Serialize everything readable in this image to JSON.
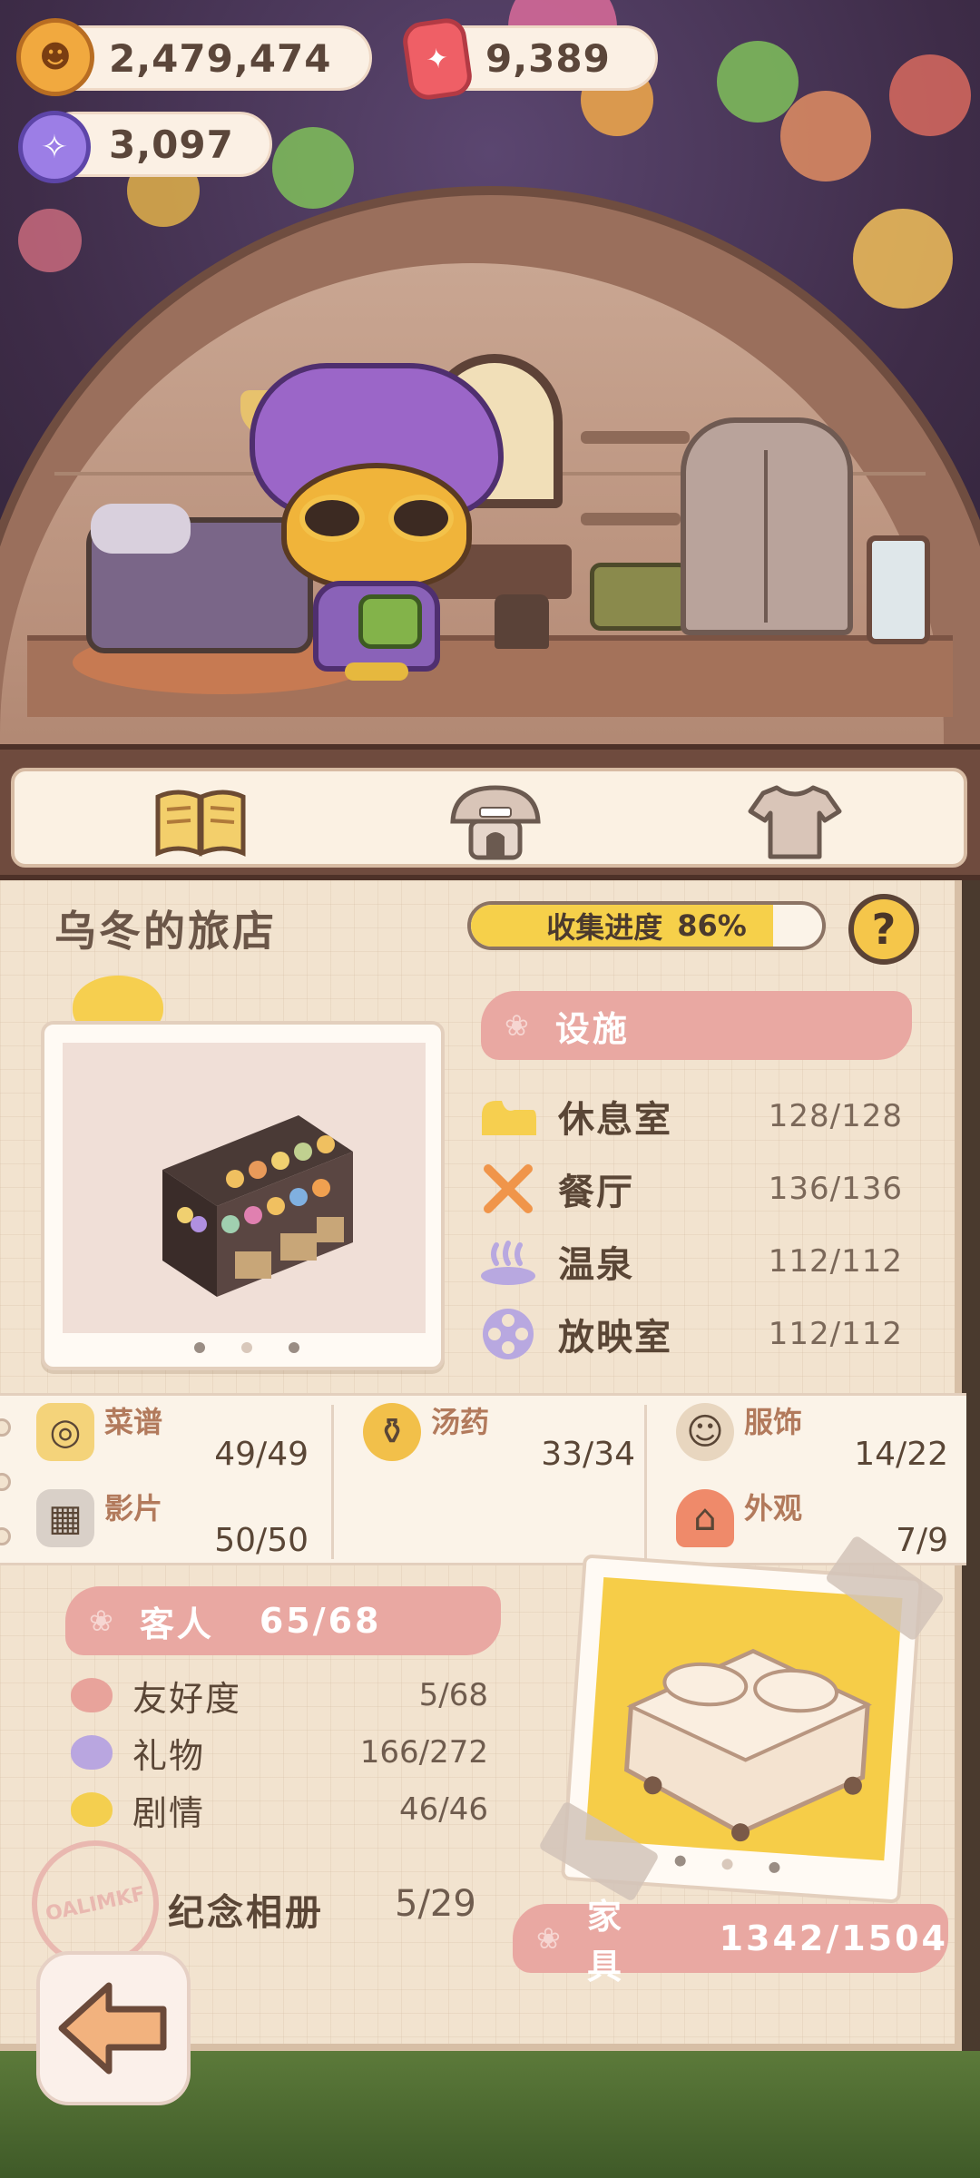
{
  "currencies": {
    "coins": "2,479,474",
    "rubies": "9,389",
    "candies": "3,097",
    "coin_icon": "cookie-coin-icon",
    "ruby_icon": "ruby-gem-icon",
    "candy_icon": "candy-icon"
  },
  "tabs": [
    {
      "name": "book-icon",
      "active": true
    },
    {
      "name": "mushroom-hotel-icon",
      "active": false
    },
    {
      "name": "shirt-icon",
      "active": false
    }
  ],
  "hotel": {
    "title": "乌冬的旅店",
    "progress_label": "收集进度",
    "progress_value": "86%",
    "progress_fraction": 0.86,
    "help": "?"
  },
  "facilities": {
    "header": "设施",
    "items": [
      {
        "name": "休息室",
        "count": "128/128",
        "icon": "bed-icon"
      },
      {
        "name": "餐厅",
        "count": "136/136",
        "icon": "fork-knife-icon"
      },
      {
        "name": "温泉",
        "count": "112/112",
        "icon": "hot-spring-icon"
      },
      {
        "name": "放映室",
        "count": "112/112",
        "icon": "film-reel-icon"
      }
    ]
  },
  "collections": [
    {
      "name": "菜谱",
      "count": "49/49",
      "icon": "recipe-icon"
    },
    {
      "name": "汤药",
      "count": "33/34",
      "icon": "potion-icon"
    },
    {
      "name": "服饰",
      "count": "14/22",
      "icon": "outfit-icon"
    },
    {
      "name": "影片",
      "count": "50/50",
      "icon": "clapperboard-icon"
    },
    {
      "name": "外观",
      "count": "7/9",
      "icon": "house-exterior-icon"
    }
  ],
  "guests": {
    "header": "客人",
    "header_count": "65/68",
    "items": [
      {
        "name": "友好度",
        "count": "5/68",
        "color": "#e8a39b"
      },
      {
        "name": "礼物",
        "count": "166/272",
        "color": "#b9a6e0"
      },
      {
        "name": "剧情",
        "count": "46/46",
        "color": "#f4cf4f"
      }
    ]
  },
  "album": {
    "label": "纪念相册",
    "count": "5/29",
    "stamp": "OALIMKF"
  },
  "furniture": {
    "label": "家具",
    "count": "1342/1504"
  },
  "colors": {
    "accent_pink": "#e9a8a2",
    "accent_yellow": "#f6d04a",
    "panel_bg": "#f2e3cf"
  }
}
